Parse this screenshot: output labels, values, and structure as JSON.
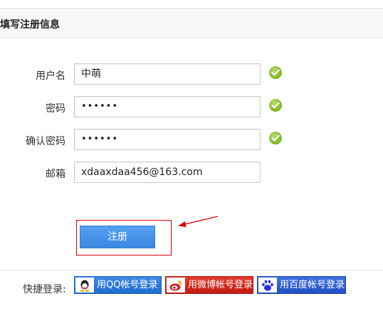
{
  "header": {
    "title": "填写注册信息"
  },
  "form": {
    "username": {
      "label": "用户名",
      "value": "中萌"
    },
    "password": {
      "label": "密码",
      "value": "••••••"
    },
    "confirm_password": {
      "label": "确认密码",
      "value": "••••••"
    },
    "email": {
      "label": "邮箱",
      "value": "xdaaxdaa456@163.com"
    }
  },
  "submit": {
    "label": "注册"
  },
  "quick_login": {
    "label": "快捷登录:",
    "buttons": [
      {
        "label": "用QQ帐号登录",
        "icon": "qq-icon",
        "color": "#2b7de0"
      },
      {
        "label": "用微博帐号登录",
        "icon": "weibo-icon",
        "color": "#d42b1f"
      },
      {
        "label": "用百度帐号登录",
        "icon": "baidu-icon",
        "color": "#2f5fd6"
      }
    ]
  },
  "colors": {
    "accent": "#4a95ec",
    "check": "#7cb522",
    "highlight": "#d60000"
  }
}
